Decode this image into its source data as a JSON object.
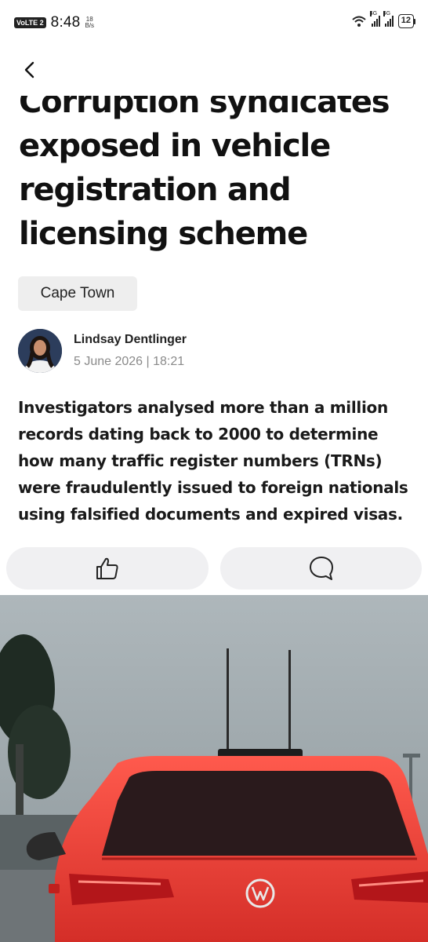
{
  "status_bar": {
    "volte": "VoLTE 2",
    "time": "8:48",
    "net_speed_value": "18",
    "net_speed_unit": "B/s",
    "sim1_label": "4G",
    "sim2_label": "4G",
    "battery_level": "12"
  },
  "article": {
    "headline": "Corruption syndicates exposed in vehicle registration and licensing scheme",
    "tag": "Cape Town",
    "author": {
      "name": "Lindsay Dentlinger",
      "date_line": "5 June 2026 | 18:21"
    },
    "summary": "Investigators analysed more than a million records dating back to 2000 to determine how many traffic register numbers (TRNs) were fraudulently issued to foreign nationals using falsified documents and expired visas."
  },
  "icons": {
    "back": "back-arrow-icon",
    "like": "thumbs-up-icon",
    "comment": "comment-bubble-icon",
    "wifi": "wifi-icon",
    "signal": "signal-icon",
    "battery": "battery-icon"
  },
  "colors": {
    "accent_car": "#e8403f",
    "pill_bg": "#f0f0f2",
    "tag_bg": "#eeeeee"
  }
}
